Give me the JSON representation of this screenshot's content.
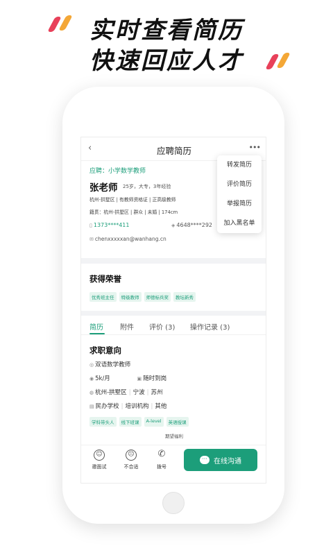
{
  "headline": {
    "line1": "实时查看简历",
    "line2": "快速回应人才"
  },
  "colors": {
    "accent_green": "#1c9e7a",
    "stripe_red": "#e8415a",
    "stripe_orange": "#f4a736"
  },
  "nav": {
    "back_icon": "‹",
    "title": "应聘简历",
    "more_icon": "•••"
  },
  "menu": {
    "items": [
      "转发简历",
      "评价简历",
      "举报简历",
      "加入黑名单"
    ]
  },
  "profile": {
    "apply_label": "应聘：小学数学教师",
    "name": "张老师",
    "meta": "25岁，大专，3年经验",
    "line1": "杭州-拱墅区 | 有教师资格证 | 正高级教师",
    "line2": "籍贯：杭州-拱墅区 | 群众 | 未婚 | 174cm",
    "phone": "1373****411",
    "wechat": "4648****292",
    "email": "chenxxxxxan@wanhang.cn"
  },
  "honor": {
    "title": "获得荣誉",
    "tags": [
      "优秀班主任",
      "特级教师",
      "师德标兵奖",
      "教坛新秀"
    ]
  },
  "tabs": [
    "简历",
    "附件",
    "评价 (3)",
    "操作记录 (3)"
  ],
  "job": {
    "title": "求职意向",
    "position": "双语数学教师",
    "salary": "5k/月",
    "availability": "随时到岗",
    "locations": [
      "杭州-拱墅区",
      "宁波",
      "苏州"
    ],
    "school_types": [
      "民办学校",
      "培训机构",
      "其他"
    ],
    "tags": [
      "学科带头人",
      "线下班课",
      "A-level",
      "英语授课"
    ],
    "peek": "期望福利"
  },
  "actions": {
    "interview": "邀面试",
    "reject": "不合适",
    "call": "拨号",
    "chat": "在线沟通"
  }
}
